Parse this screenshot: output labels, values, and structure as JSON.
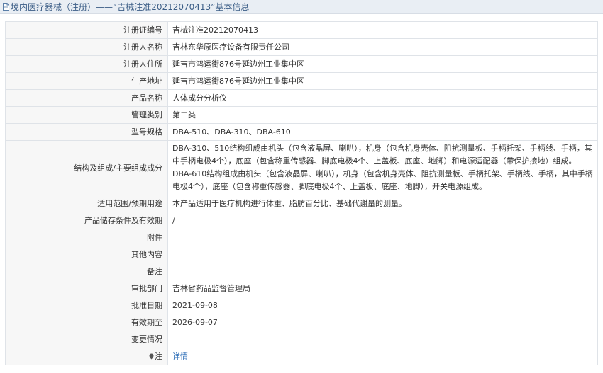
{
  "page_title": "境内医疗器械（注册）——“吉械注准20212070413”基本信息",
  "rows": [
    {
      "label": "注册证编号",
      "value": "吉械注准20212070413"
    },
    {
      "label": "注册人名称",
      "value": "吉林东华原医疗设备有限责任公司"
    },
    {
      "label": "注册人住所",
      "value": "延吉市鸿运街876号延边州工业集中区"
    },
    {
      "label": "生产地址",
      "value": "延吉市鸿运街876号延边州工业集中区"
    },
    {
      "label": "产品名称",
      "value": "人体成分分析仪"
    },
    {
      "label": "管理类别",
      "value": "第二类"
    },
    {
      "label": "型号规格",
      "value": "DBA-510、DBA-310、DBA-610"
    },
    {
      "label": "结构及组成/主要组成成分",
      "value": "DBA-310、510结构组成由机头（包含液晶屏、喇叭），机身（包含机身壳体、阻抗测量板、手柄托架、手柄线、手柄，其中手柄电极4个），底座（包含称重传感器、脚底电极4个、上盖板、底座、地脚）和电源适配器（带保护接地）组成。DBA-610结构组成由机头（包含液晶屏、喇叭），机身（包含机身壳体、阻抗测量板、手柄托架、手柄线、手柄，其中手柄电极4个），底座（包含称重传感器、脚底电极4个、上盖板、底座、地脚），开关电源组成。"
    },
    {
      "label": "适用范围/预期用途",
      "value": "本产品适用于医疗机构进行体重、脂肪百分比、基础代谢量的测量。"
    },
    {
      "label": "产品储存条件及有效期",
      "value": "/"
    },
    {
      "label": "附件",
      "value": ""
    },
    {
      "label": "其他内容",
      "value": ""
    },
    {
      "label": "备注",
      "value": ""
    },
    {
      "label": "审批部门",
      "value": "吉林省药品监督管理局"
    },
    {
      "label": "批准日期",
      "value": "2021-09-08"
    },
    {
      "label": "有效期至",
      "value": "2026-09-07"
    },
    {
      "label": "变更情况",
      "value": ""
    },
    {
      "label": "注",
      "value": "详情"
    }
  ],
  "icons": {
    "title": "document-icon",
    "note": "note-icon"
  },
  "colors": {
    "header_bg": "#e9eef4",
    "title_text": "#3b5d86",
    "label_bg": "#f7f7f7",
    "border": "#dfe3e8",
    "link": "#2f6fb8"
  }
}
